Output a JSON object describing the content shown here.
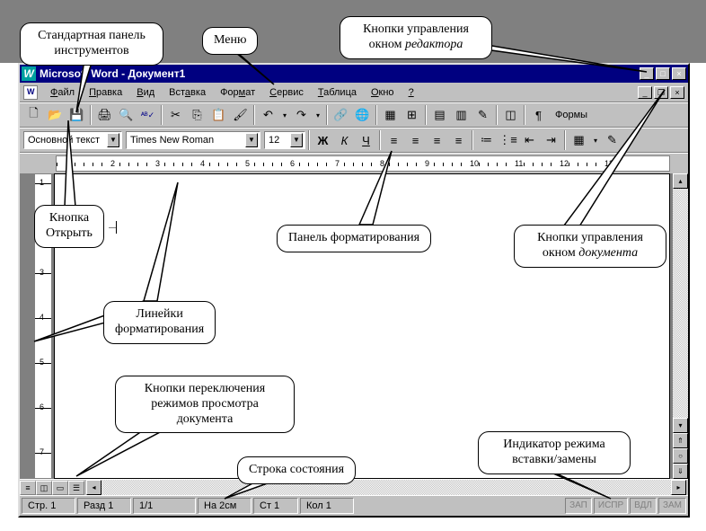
{
  "title": "Microsoft Word - Документ1",
  "menu": [
    "Файл",
    "Правка",
    "Вид",
    "Вставка",
    "Формат",
    "Сервис",
    "Таблица",
    "Окно",
    "?"
  ],
  "std_toolbar_extra": "Формы",
  "style_combo": "Основной текст",
  "font_combo": "Times New Roman",
  "size_combo": "12",
  "bold": "Ж",
  "italic": "К",
  "underline": "Ч",
  "ruler_nums": [
    "1",
    "2",
    "3",
    "4",
    "5",
    "6",
    "7",
    "8",
    "9",
    "10",
    "11",
    "12",
    "13"
  ],
  "status": {
    "page": "Стр. 1",
    "section": "Разд 1",
    "pages": "1/1",
    "at": "На 2см",
    "line": "Ст 1",
    "col": "Кол 1",
    "indicators": [
      "ЗАП",
      "ИСПР",
      "ВДЛ",
      "ЗАМ"
    ]
  },
  "callouts": {
    "std_toolbar": "Стандартная панель\nинструментов",
    "menu_label": "Меню",
    "editor_wincontrols": "Кнопки управления\nокном ",
    "editor_wincontrols_em": "редактора",
    "open_btn": "Кнопка\nОткрыть",
    "rulers": "Линейки\nформатирования",
    "fmt_panel": "Панель форматирования",
    "doc_wincontrols": "Кнопки управления\nокном ",
    "doc_wincontrols_em": "документа",
    "view_btns": "Кнопки переключения\nрежимов просмотра\nдокумента",
    "status_label": "Строка состояния",
    "ins_ind": "Индикатор режима\nвставки/замены"
  }
}
